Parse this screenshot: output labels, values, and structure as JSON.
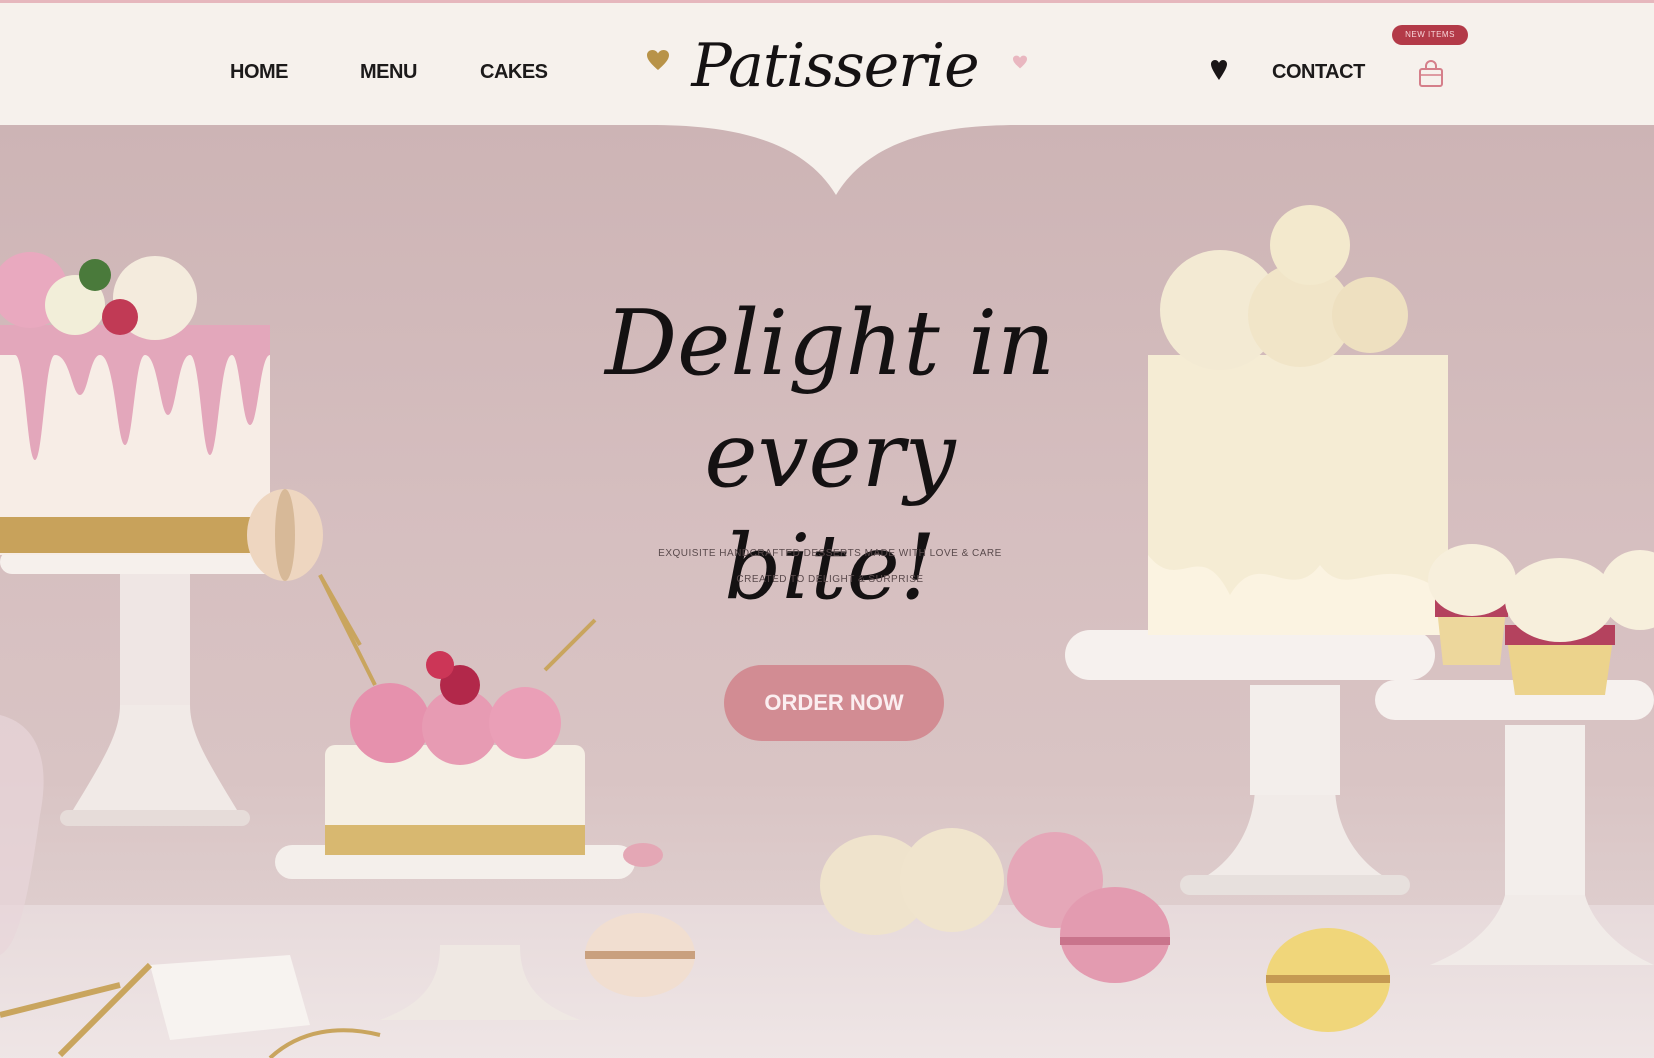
{
  "nav": {
    "links": [
      "HOME",
      "MENU",
      "CAKES"
    ],
    "logo": "Patisserie",
    "contact": "CONTACT",
    "cart_badge": "NEW ITEMS"
  },
  "hero": {
    "headline_line1": "Delight in",
    "headline_line2": "every bite!",
    "subtext_line1": "EXQUISITE HANDCRAFTED DESSERTS MADE WITH LOVE & CARE",
    "subtext_line2": "CREATED TO DELIGHT & SURPRISE",
    "cta_label": "ORDER NOW"
  },
  "colors": {
    "accent": "#d28c93",
    "badge": "#b33a48",
    "nav_bg": "#f6f1ec",
    "hero_bg": "#d6bfc0"
  },
  "icons": [
    "heart-gold-icon",
    "heart-pink-icon",
    "heart-black-icon",
    "shopping-bag-icon"
  ]
}
